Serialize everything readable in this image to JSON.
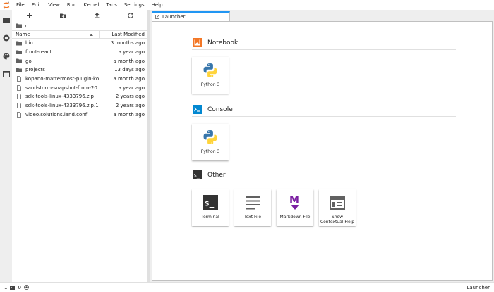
{
  "menubar": {
    "items": [
      "File",
      "Edit",
      "View",
      "Run",
      "Kernel",
      "Tabs",
      "Settings",
      "Help"
    ]
  },
  "activity": {
    "icons": [
      "folder-icon",
      "running-icon",
      "palette-icon",
      "tabs-icon"
    ]
  },
  "filebrowser": {
    "toolbar": [
      "new-launcher-icon",
      "new-folder-icon",
      "upload-icon",
      "refresh-icon"
    ],
    "breadcrumb": "/",
    "header": {
      "name": "Name",
      "modified": "Last Modified"
    },
    "files": [
      {
        "name": "bin",
        "type": "folder",
        "modified": "3 months ago"
      },
      {
        "name": "front-react",
        "type": "folder",
        "modified": "a year ago"
      },
      {
        "name": "go",
        "type": "folder",
        "modified": "a month ago"
      },
      {
        "name": "projects",
        "type": "folder",
        "modified": "13 days ago"
      },
      {
        "name": "kopano-mattermost-plugin-kopan...",
        "type": "file",
        "modified": "a month ago"
      },
      {
        "name": "sandstorm-snapshot-from-2018-1...",
        "type": "file",
        "modified": "a year ago"
      },
      {
        "name": "sdk-tools-linux-4333796.zip",
        "type": "file",
        "modified": "2 years ago"
      },
      {
        "name": "sdk-tools-linux-4333796.zip.1",
        "type": "file",
        "modified": "2 years ago"
      },
      {
        "name": "video.solutions.land.conf",
        "type": "file",
        "modified": "a month ago"
      }
    ]
  },
  "dock": {
    "tab_label": "Launcher",
    "sections": {
      "notebook": {
        "title": "Notebook",
        "cards": [
          "Python 3"
        ]
      },
      "console": {
        "title": "Console",
        "cards": [
          "Python 3"
        ]
      },
      "other": {
        "title": "Other",
        "cards": [
          "Terminal",
          "Text File",
          "Markdown File",
          "Show Contextual Help"
        ]
      }
    }
  },
  "statusbar": {
    "count1": "1",
    "count2": "0",
    "right": "Launcher"
  },
  "colors": {
    "accent": "#2196f3",
    "notebook": "#f37726",
    "console": "#0288d1",
    "markdown": "#7b1fa2",
    "folder": "#616161"
  }
}
